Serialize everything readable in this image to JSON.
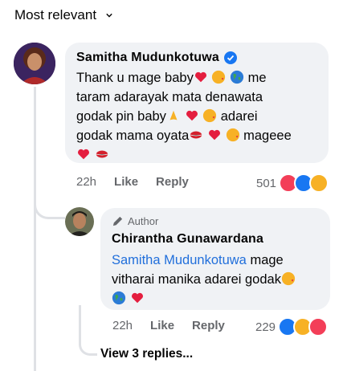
{
  "sort": {
    "label": "Most relevant"
  },
  "comment": {
    "author": "Samitha  Mudunkotuwa",
    "lines": [
      "Thank u mage baby",
      "taram adarayak mata denawata",
      "godak pin baby",
      "godak mama oyata"
    ],
    "line1_tail": "me",
    "line3_tail": "adarei",
    "line4_tail": "mageee",
    "time": "22h",
    "like": "Like",
    "reply": "Reply",
    "reaction_count": "501"
  },
  "reply": {
    "badge": "Author",
    "author": "Chirantha Gunawardana",
    "mention": "Samitha  Mudunkotuwa",
    "line1_tail": "mage",
    "line2": "vitharai manika adarei godak",
    "time": "22h",
    "like": "Like",
    "reply": "Reply",
    "reaction_count": "229"
  },
  "view_replies": "View 3 replies...",
  "colors": {
    "accent": "#216fdb",
    "muted": "#65676b",
    "bubble": "#f0f2f5"
  }
}
